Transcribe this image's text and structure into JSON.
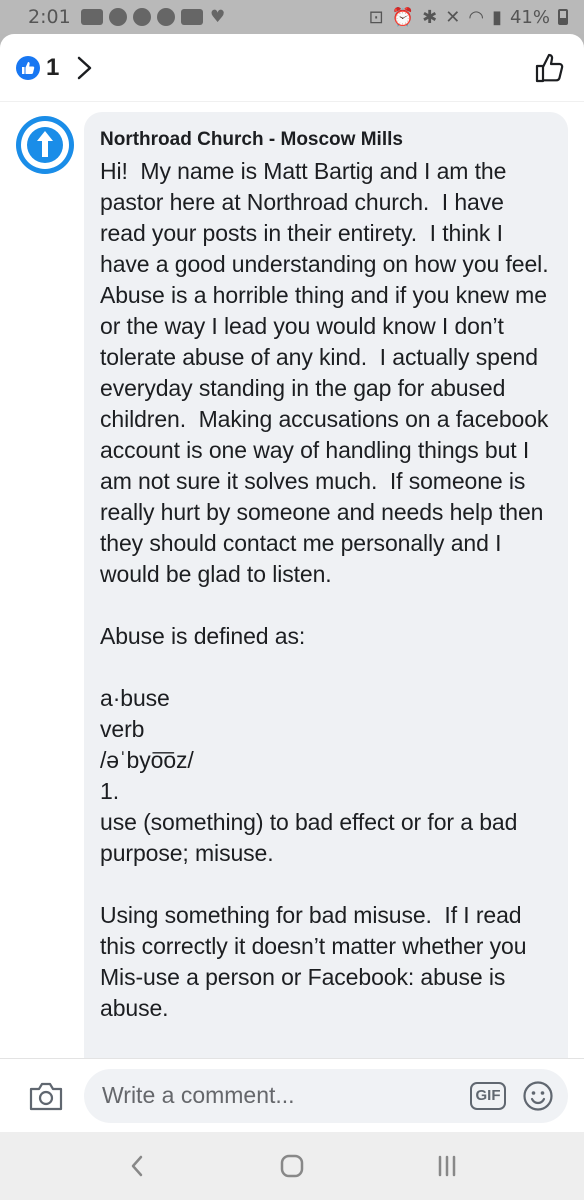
{
  "status_bar": {
    "time": "2:01",
    "battery": "41%"
  },
  "reactions": {
    "count": "1"
  },
  "comment": {
    "author": "Northroad Church - Moscow Mills",
    "body": "Hi!  My name is Matt Bartig and I am the pastor here at Northroad church.  I have read your posts in their entirety.  I think I have a good understanding on how you feel.  Abuse is a horrible thing and if you knew me or the way I lead you would know I don’t tolerate abuse of any kind.  I actually spend everyday standing in the gap for abused children.  Making accusations on a facebook account is one way of handling things but I am not sure it solves much.  If someone is really hurt by someone and needs help then they should contact me personally and I would be glad to listen.\n\nAbuse is defined as:\n\na·buse\nverb\n/əˈbyo͞oz/\n1.\nuse (something) to bad effect or for a bad purpose; misuse.\n\nUsing something for bad misuse.  If I read this correctly it doesn’t matter whether you Mis-use a person or Facebook: abuse is abuse."
  },
  "composer": {
    "placeholder": "Write a comment...",
    "gif_label": "GIF"
  },
  "colors": {
    "facebook_blue": "#1877f2",
    "avatar_blue": "#1a8de8",
    "bubble_bg": "#eff1f4"
  },
  "icons": [
    "like-icon",
    "chevron-right-icon",
    "thumbs-up-outline-icon",
    "camera-icon",
    "gif-icon",
    "emoji-icon",
    "back-icon",
    "home-icon",
    "recents-icon"
  ]
}
